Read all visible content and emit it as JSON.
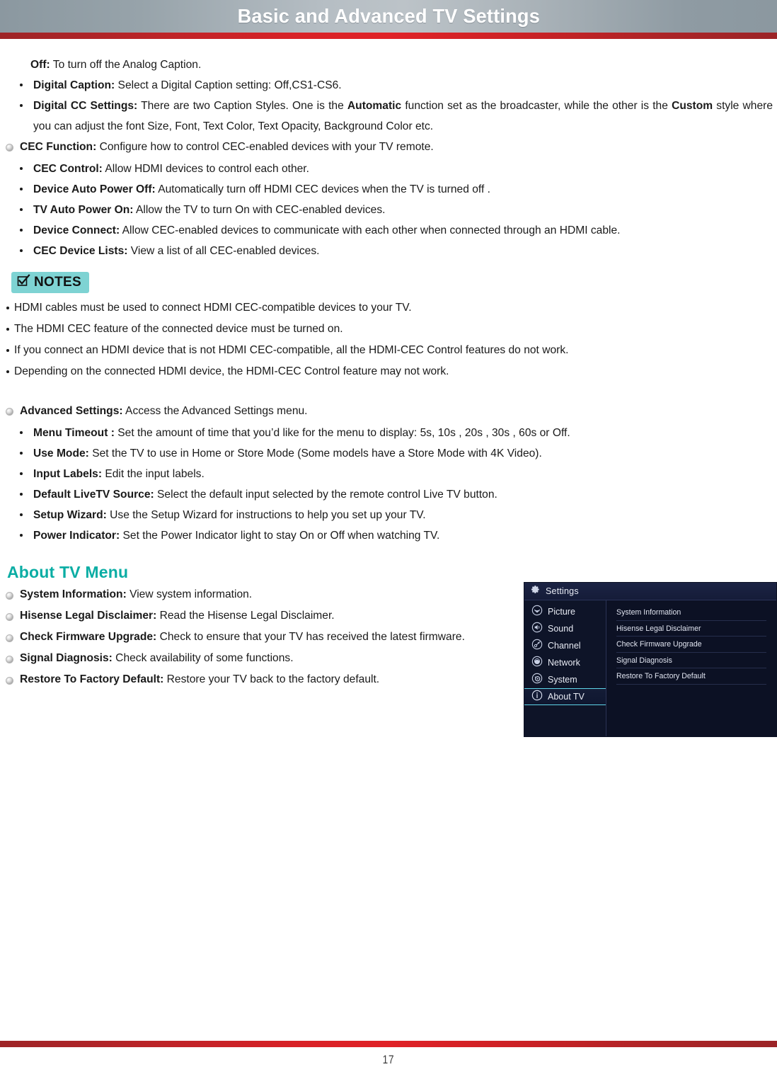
{
  "header": {
    "title": "Basic and Advanced TV Settings",
    "bar_color": "#d82227",
    "bg_color": "#b6bec4"
  },
  "caption_section": {
    "off_label": "Off:",
    "off_text": " To turn off the Analog Caption.",
    "items": [
      {
        "label": "Digital Caption:",
        "text": " Select a Digital Caption setting: Off,CS1-CS6."
      },
      {
        "label": "Digital CC Settings:",
        "text": " There are two Caption Styles. One is the ",
        "bold_mid": "Automatic",
        "text2": " function set as the broadcaster, while the other is the ",
        "bold_mid2": "Custom",
        "text3": " style where you can adjust the font Size, Font, Text Color, Text Opacity, Background Color etc."
      }
    ]
  },
  "cec_section": {
    "heading_label": "CEC Function:",
    "heading_text": " Configure how to control CEC-enabled devices with your TV remote.",
    "items": [
      {
        "label": "CEC Control:",
        "text": " Allow HDMI devices to control each other."
      },
      {
        "label": "Device Auto Power Off:",
        "text": " Automatically turn off HDMI CEC devices when the TV is turned off ."
      },
      {
        "label": "TV Auto Power On:",
        "text": " Allow the TV to turn On with CEC-enabled devices."
      },
      {
        "label": "Device Connect:",
        "text": " Allow CEC-enabled devices to communicate with each other when connected through an HDMI cable."
      },
      {
        "label": "CEC Device Lists:",
        "text": " View a list of all CEC-enabled devices."
      }
    ]
  },
  "notes": {
    "badge_label": "NOTES",
    "badge_color": "#7ed3d3",
    "lines": [
      "HDMI cables must be used to connect HDMI CEC-compatible devices to your TV.",
      "The HDMI CEC feature of the connected device must be turned on.",
      "If you connect an HDMI device that is not HDMI CEC-compatible, all the HDMI-CEC Control features do not work.",
      "Depending on the connected HDMI device, the HDMI-CEC Control feature may not work."
    ]
  },
  "advanced_section": {
    "heading_label": "Advanced Settings:",
    "heading_text": " Access the Advanced Settings menu.",
    "items": [
      {
        "label": "Menu Timeout :",
        "text": " Set the amount of time that you’d like for the menu to display: 5s, 10s , 20s , 30s , 60s or Off."
      },
      {
        "label": "Use Mode:",
        "text": " Set the TV to use in Home or Store Mode (Some models have a Store Mode with 4K Video)."
      },
      {
        "label": "Input Labels:",
        "text": " Edit the input labels."
      },
      {
        "label": "Default LiveTV Source:",
        "text": " Select the default input selected by the remote control Live TV button."
      },
      {
        "label": "Setup Wizard:",
        "text": " Use the Setup Wizard for instructions to help you set up your TV."
      },
      {
        "label": "Power Indicator:",
        "text": " Set the Power Indicator light to stay On or Off when watching TV."
      }
    ]
  },
  "about_section": {
    "heading": "About TV Menu",
    "heading_color": "#0aada4",
    "items": [
      {
        "label": "System Information:",
        "text": " View system information."
      },
      {
        "label": "Hisense Legal Disclaimer:",
        "text": " Read the Hisense Legal Disclaimer."
      },
      {
        "label": "Check Firmware Upgrade:",
        "text": " Check to ensure that your TV has received the latest firmware."
      },
      {
        "label": "Signal Diagnosis:",
        "text": " Check availability of some functions."
      },
      {
        "label": "Restore To Factory Default:",
        "text": " Restore your TV back to the factory default."
      }
    ]
  },
  "osd": {
    "title": "Settings",
    "accent_color": "#5fd5e8",
    "sidebar": [
      {
        "label": "Picture",
        "icon": "picture-icon",
        "active": false
      },
      {
        "label": "Sound",
        "icon": "speaker-icon",
        "active": false
      },
      {
        "label": "Channel",
        "icon": "antenna-icon",
        "active": false
      },
      {
        "label": "Network",
        "icon": "network-icon",
        "active": false
      },
      {
        "label": "System",
        "icon": "system-gear-icon",
        "active": false
      },
      {
        "label": "About TV",
        "icon": "info-icon",
        "active": true
      }
    ],
    "rows": [
      "System Information",
      "Hisense Legal Disclaimer",
      "Check Firmware Upgrade",
      "Signal Diagnosis",
      "Restore To Factory Default"
    ]
  },
  "footer": {
    "page_number": "17",
    "bar_color": "#d82227"
  }
}
